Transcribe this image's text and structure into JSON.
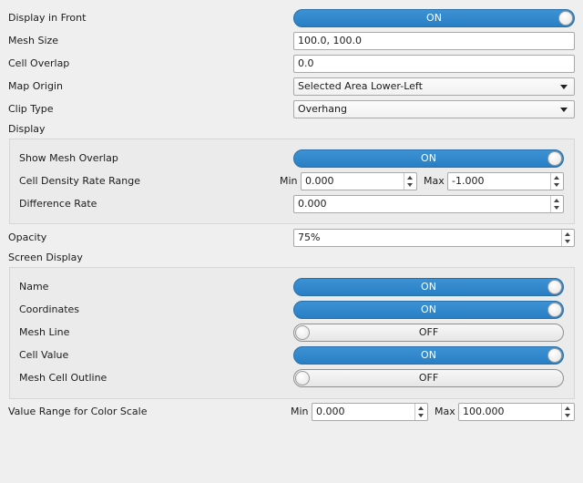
{
  "display_in_front": {
    "label": "Display in Front",
    "state": "ON"
  },
  "mesh_size": {
    "label": "Mesh Size",
    "value": "100.0, 100.0"
  },
  "cell_overlap": {
    "label": "Cell Overlap",
    "value": "0.0"
  },
  "map_origin": {
    "label": "Map Origin",
    "value": "Selected Area Lower-Left"
  },
  "clip_type": {
    "label": "Clip Type",
    "value": "Overhang"
  },
  "display": {
    "title": "Display",
    "show_mesh_overlap": {
      "label": "Show Mesh Overlap",
      "state": "ON"
    },
    "cell_density_rate_range": {
      "label": "Cell Density Rate Range",
      "min_label": "Min",
      "min_value": "0.000",
      "max_label": "Max",
      "max_value": "-1.000"
    },
    "difference_rate": {
      "label": "Difference Rate",
      "value": "0.000"
    }
  },
  "opacity": {
    "label": "Opacity",
    "value": "75%"
  },
  "screen_display": {
    "title": "Screen Display",
    "name": {
      "label": "Name",
      "state": "ON"
    },
    "coordinates": {
      "label": "Coordinates",
      "state": "ON"
    },
    "mesh_line": {
      "label": "Mesh Line",
      "state": "OFF"
    },
    "cell_value": {
      "label": "Cell Value",
      "state": "ON"
    },
    "mesh_cell_outline": {
      "label": "Mesh Cell Outline",
      "state": "OFF"
    }
  },
  "value_range_color_scale": {
    "label": "Value Range for Color Scale",
    "min_label": "Min",
    "min_value": "0.000",
    "max_label": "Max",
    "max_value": "100.000"
  },
  "colors": {
    "accent": "#2f86c9",
    "background": "#efefef"
  }
}
